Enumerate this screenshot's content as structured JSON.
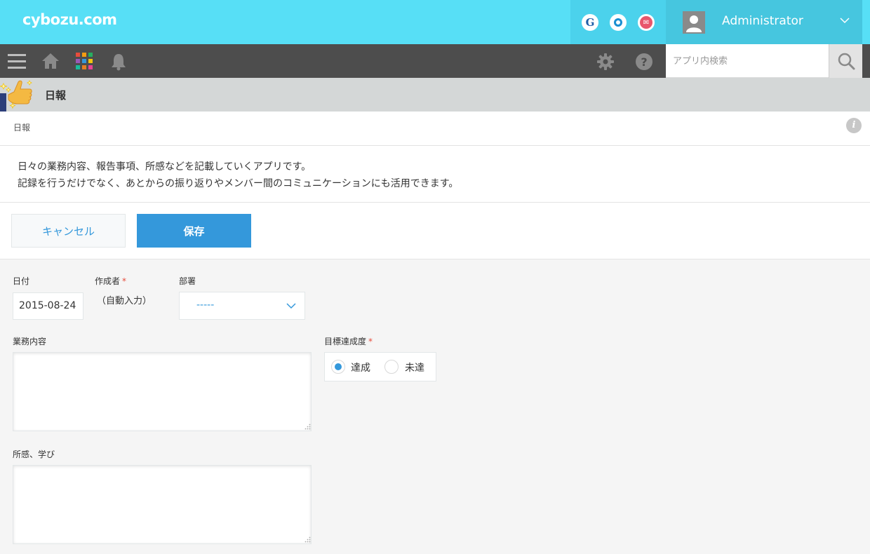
{
  "header": {
    "brand": "cybozu.com",
    "services": [
      {
        "name": "garoon",
        "glyph": "G",
        "color": "#1f5fa8"
      },
      {
        "name": "office",
        "glyph": "O",
        "color": "#1a8fd1"
      },
      {
        "name": "mailwise",
        "glyph": "✉",
        "color": "#e8566c"
      }
    ],
    "user_name": "Administrator"
  },
  "nav": {
    "search_placeholder": "アプリ内検索"
  },
  "app": {
    "title": "日報",
    "breadcrumb": "日報",
    "info_glyph": "i",
    "description": [
      "日々の業務内容、報告事項、所感などを記載していくアプリです。",
      "記録を行うだけでなく、あとからの振り返りやメンバー間のコミュニケーションにも活用できます。"
    ]
  },
  "actions": {
    "cancel_label": "キャンセル",
    "save_label": "保存"
  },
  "form": {
    "date": {
      "label": "日付",
      "value": "2015-08-24"
    },
    "creator": {
      "label": "作成者",
      "required_mark": "*",
      "value": "（自動入力）"
    },
    "department": {
      "label": "部署",
      "value": "-----"
    },
    "work_content": {
      "label": "業務内容",
      "value": ""
    },
    "goal": {
      "label": "目標達成度",
      "required_mark": "*",
      "options": [
        "達成",
        "未達"
      ],
      "selected": "達成"
    },
    "impressions": {
      "label": "所感、学び",
      "value": ""
    }
  },
  "colors": {
    "topbar": "#57dff6",
    "navbar": "#4d4d4d",
    "accent": "#3498db",
    "required": "#e74c3c"
  }
}
